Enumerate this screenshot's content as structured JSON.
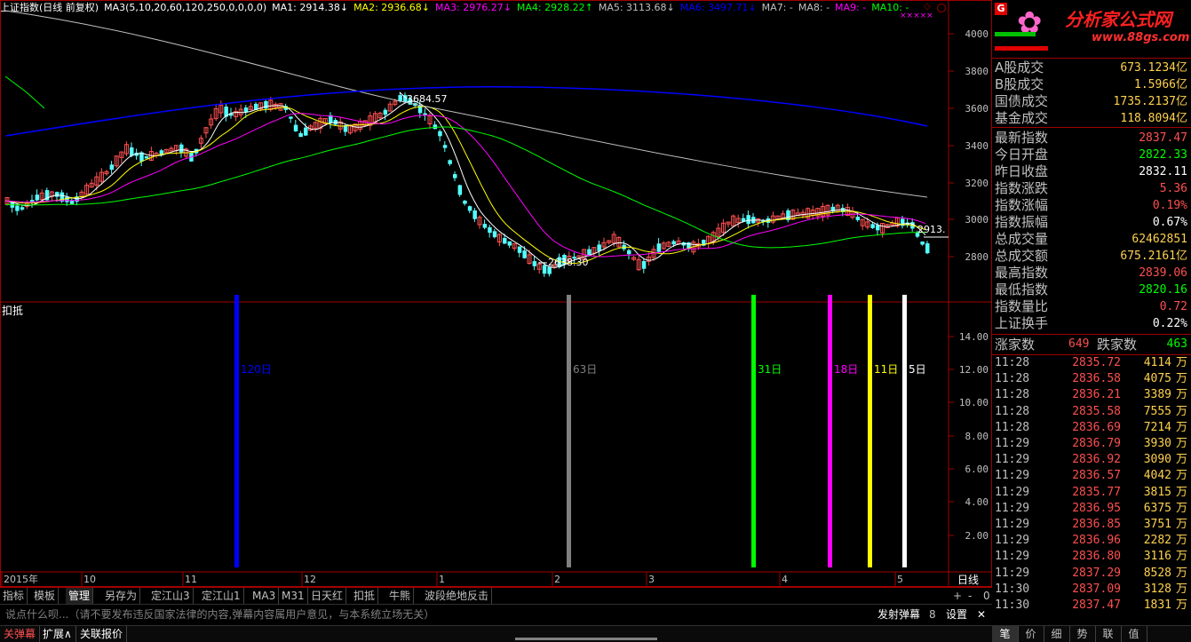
{
  "header": {
    "title": "上证指数(日线 前复权)",
    "ma3_label": "MA3(5,10,20,60,120,250,0,0,0,0)",
    "ma_items": [
      {
        "text": "MA1: 2914.38↓",
        "color": "#ffffff"
      },
      {
        "text": "MA2: 2936.68↓",
        "color": "#ffff00"
      },
      {
        "text": "MA3: 2976.27↓",
        "color": "#ff00ff"
      },
      {
        "text": "MA4: 2928.22↑",
        "color": "#00ff00"
      },
      {
        "text": "MA5: 3113.68↓",
        "color": "#c0c0c0"
      },
      {
        "text": "MA6: 3497.71↓",
        "color": "#0000ff"
      },
      {
        "text": "MA7: -",
        "color": "#c0c0c0"
      },
      {
        "text": "MA8: -",
        "color": "#c0c0c0"
      },
      {
        "text": "MA9: -",
        "color": "#ff00ff"
      },
      {
        "text": "MA10: -",
        "color": "#00ff00"
      }
    ],
    "corner_marker": "×××××",
    "corner_diamond": "◇"
  },
  "main_chart": {
    "y_ticks": [
      "4000",
      "3800",
      "3600",
      "3400",
      "3200",
      "3000",
      "2800"
    ],
    "high_label": "3684.57",
    "low_label": "2638.30",
    "last_label": "2913."
  },
  "sub_chart": {
    "title": "扣抵",
    "y_ticks": [
      "14.00",
      "12.00",
      "10.00",
      "8.00",
      "6.00",
      "4.00",
      "2.00"
    ],
    "bars": [
      {
        "label": "120日",
        "color": "#0000ff"
      },
      {
        "label": "63日",
        "color": "#808080"
      },
      {
        "label": "31日",
        "color": "#00ff00"
      },
      {
        "label": "18日",
        "color": "#ff00ff"
      },
      {
        "label": "11日",
        "color": "#ffff00"
      },
      {
        "label": "5日",
        "color": "#ffffff"
      }
    ]
  },
  "x_axis": {
    "labels": [
      "2015年",
      "10",
      "11",
      "12",
      "1",
      "2",
      "3",
      "4",
      "5"
    ],
    "period": "日线"
  },
  "tabs": [
    "指标",
    "模板",
    "管理",
    "另存为",
    "定江山3",
    "定江山1",
    "MA3",
    "M31",
    "日天红",
    "扣抵",
    "牛熊",
    "波段绝地反击"
  ],
  "tab_controls": [
    "+",
    "-",
    "0"
  ],
  "comment_bar": {
    "placeholder": "说点什么呗...（请不要发布违反国家法律的内容,弹幕内容属用户意见，与本系统立场无关）",
    "send_label": "发射弹幕",
    "count": "8",
    "settings_label": "设置",
    "close": "✕"
  },
  "status_bar": [
    "关弹幕",
    "扩展∧",
    "关联报价"
  ],
  "right_panel": {
    "logo_title": "分析家公式网",
    "logo_url": "www.88gs.com",
    "g_badge": "G",
    "market": [
      {
        "k": "A股成交",
        "v": "673.1234亿",
        "color": "#ffd24d"
      },
      {
        "k": "B股成交",
        "v": "1.5966亿",
        "color": "#ffd24d"
      },
      {
        "k": "国债成交",
        "v": "1735.2137亿",
        "color": "#ffd24d"
      },
      {
        "k": "基金成交",
        "v": "118.8094亿",
        "color": "#ffd24d"
      }
    ],
    "index": [
      {
        "k": "最新指数",
        "v": "2837.47",
        "color": "#ff5050"
      },
      {
        "k": "今日开盘",
        "v": "2822.33",
        "color": "#00ff00"
      },
      {
        "k": "昨日收盘",
        "v": "2832.11",
        "color": "#ffffff"
      },
      {
        "k": "指数涨跌",
        "v": "5.36",
        "color": "#ff5050"
      },
      {
        "k": "指数涨幅",
        "v": "0.19%",
        "color": "#ff5050"
      },
      {
        "k": "指数振幅",
        "v": "0.67%",
        "color": "#ffffff"
      },
      {
        "k": "总成交量",
        "v": "62462851",
        "color": "#ffd24d"
      },
      {
        "k": "总成交额",
        "v": "675.2161亿",
        "color": "#ffd24d"
      },
      {
        "k": "最高指数",
        "v": "2839.06",
        "color": "#ff5050"
      },
      {
        "k": "最低指数",
        "v": "2820.16",
        "color": "#00ff00"
      },
      {
        "k": "指数量比",
        "v": "0.72",
        "color": "#ff5050"
      },
      {
        "k": "上证换手",
        "v": "0.22%",
        "color": "#ffffff"
      }
    ],
    "breadth": {
      "up_label": "涨家数",
      "up_value": "649",
      "down_label": "跌家数",
      "down_value": "463"
    },
    "ticks": [
      {
        "t": "11:28",
        "p": "2835.72",
        "v": "4114",
        "u": "万"
      },
      {
        "t": "11:28",
        "p": "2836.58",
        "v": "4075",
        "u": "万"
      },
      {
        "t": "11:28",
        "p": "2836.21",
        "v": "3389",
        "u": "万"
      },
      {
        "t": "11:28",
        "p": "2835.58",
        "v": "7555",
        "u": "万"
      },
      {
        "t": "11:28",
        "p": "2836.69",
        "v": "7214",
        "u": "万"
      },
      {
        "t": "11:29",
        "p": "2836.79",
        "v": "3930",
        "u": "万"
      },
      {
        "t": "11:29",
        "p": "2836.92",
        "v": "3090",
        "u": "万"
      },
      {
        "t": "11:29",
        "p": "2836.57",
        "v": "4042",
        "u": "万"
      },
      {
        "t": "11:29",
        "p": "2835.77",
        "v": "3815",
        "u": "万"
      },
      {
        "t": "11:29",
        "p": "2836.95",
        "v": "6375",
        "u": "万"
      },
      {
        "t": "11:29",
        "p": "2836.85",
        "v": "3751",
        "u": "万"
      },
      {
        "t": "11:29",
        "p": "2836.96",
        "v": "2282",
        "u": "万"
      },
      {
        "t": "11:29",
        "p": "2836.80",
        "v": "3116",
        "u": "万"
      },
      {
        "t": "11:29",
        "p": "2837.29",
        "v": "8528",
        "u": "万"
      },
      {
        "t": "11:30",
        "p": "2837.09",
        "v": "3128",
        "u": "万"
      },
      {
        "t": "11:30",
        "p": "2837.47",
        "v": "1831",
        "u": "万"
      }
    ],
    "bottom_tabs": [
      "笔",
      "价",
      "细",
      "势",
      "联",
      "值"
    ]
  },
  "colors": {
    "up": "#ff5050",
    "down": "#54ffff",
    "frame": "#a00000"
  }
}
